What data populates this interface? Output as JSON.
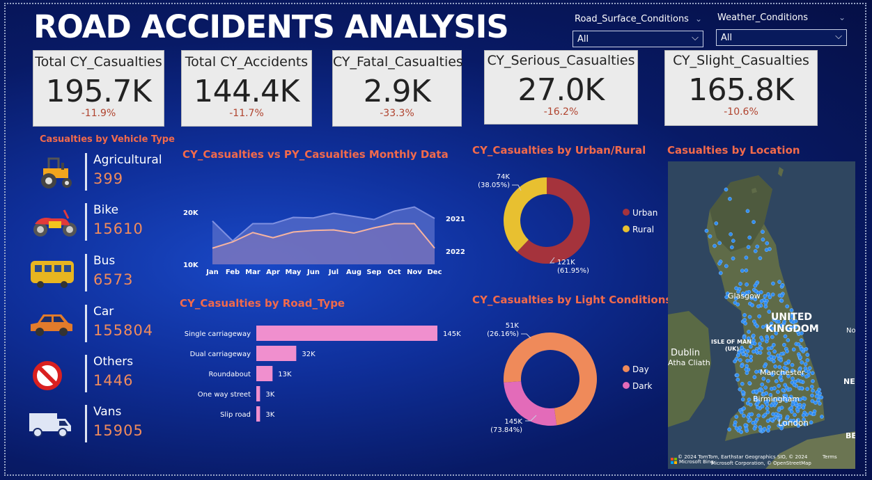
{
  "title": "ROAD ACCIDENTS ANALYSIS",
  "slicers": [
    {
      "label": "Road_Surface_Conditions",
      "value": "All"
    },
    {
      "label": "Weather_Conditions",
      "value": "All"
    }
  ],
  "cards": [
    {
      "label": "Total CY_Casualties",
      "value": "195.7K",
      "delta": "-11.9%"
    },
    {
      "label": "Total CY_Accidents",
      "value": "144.4K",
      "delta": "-11.7%"
    },
    {
      "label": "CY_Fatal_Casualties",
      "value": "2.9K",
      "delta": "-33.3%"
    },
    {
      "label": "CY_Serious_Casualties",
      "value": "27.0K",
      "delta": "-16.2%"
    },
    {
      "label": "CY_Slight_Casualties",
      "value": "165.8K",
      "delta": "-10.6%"
    }
  ],
  "vehicle": {
    "title": "Casualties by Vehicle Type",
    "items": [
      {
        "name": "Agricultural",
        "value": "399",
        "icon": "tractor-icon"
      },
      {
        "name": "Bike",
        "value": "15610",
        "icon": "motorbike-icon"
      },
      {
        "name": "Bus",
        "value": "6573",
        "icon": "bus-icon"
      },
      {
        "name": "Car",
        "value": "155804",
        "icon": "car-icon"
      },
      {
        "name": "Others",
        "value": "1446",
        "icon": "prohibited-icon"
      },
      {
        "name": "Vans",
        "value": "15905",
        "icon": "van-icon"
      }
    ]
  },
  "colors": {
    "accent_title": "#f26a4b",
    "urban": "#a5333c",
    "rural": "#e8c030",
    "day": "#ef8a5a",
    "dark": "#e36bb9",
    "bar": "#f08fce",
    "area_2021": "#5a6fc9",
    "line_2022": "#f7b4a0"
  },
  "charts": {
    "monthly": {
      "title": "CY_Casualties vs PY_Casualties Monthly Data",
      "y_ticks": [
        "20K",
        "10K"
      ]
    },
    "road_type": {
      "title": "CY_Casualties by Road_Type"
    },
    "urban_rural": {
      "title": "CY_Casualties by Urban/Rural"
    },
    "light": {
      "title": "CY_Casualties by Light Conditions"
    }
  },
  "chart_data": [
    {
      "type": "area",
      "categories": [
        "Jan",
        "Feb",
        "Mar",
        "Apr",
        "May",
        "Jun",
        "Jul",
        "Aug",
        "Sep",
        "Oct",
        "Nov",
        "Dec"
      ],
      "series": [
        {
          "name": "2021",
          "values": [
            18.3,
            14.5,
            17.8,
            17.8,
            19.0,
            18.9,
            19.8,
            19.2,
            18.6,
            20.2,
            21.0,
            18.8
          ]
        },
        {
          "name": "2022",
          "values": [
            13.1,
            14.3,
            16.1,
            15.1,
            16.2,
            16.5,
            16.6,
            16.0,
            17.0,
            17.8,
            17.8,
            13.1
          ]
        }
      ],
      "ylim": [
        10,
        22
      ]
    },
    {
      "type": "bar",
      "categories": [
        "Single carriageway",
        "Dual carriageway",
        "Roundabout",
        "One way street",
        "Slip road"
      ],
      "values": [
        145,
        32,
        13,
        3,
        3
      ],
      "labels": [
        "145K",
        "32K",
        "13K",
        "3K",
        "3K"
      ]
    },
    {
      "type": "pie",
      "categories": [
        "Urban",
        "Rural"
      ],
      "values": [
        121,
        74
      ],
      "percent": [
        61.95,
        38.05
      ],
      "labels": [
        "121K",
        "74K"
      ],
      "pct_labels": [
        "(61.95%)",
        "(38.05%)"
      ]
    },
    {
      "type": "pie",
      "categories": [
        "Day",
        "Dark"
      ],
      "values": [
        145,
        51
      ],
      "percent": [
        73.84,
        26.16
      ],
      "labels": [
        "145K",
        "51K"
      ],
      "pct_labels": [
        "(73.84%)",
        "(26.16%)"
      ]
    }
  ],
  "map": {
    "title": "Casualties by Location",
    "labels": [
      "UNITED",
      "KINGDOM",
      "Glasgow",
      "Dublin",
      "Atha Cliath",
      "ISLE OF MAN",
      "(UK)",
      "Manchester",
      "Birmingham",
      "London",
      "NE",
      "No",
      "BE"
    ],
    "copyright1": "© 2024 TomTom, Earthstar Geographics SIO, © 2024",
    "copyright2": "Microsoft Corporation, © OpenStreetMap",
    "terms": "Terms",
    "bing": "Microsoft Bing"
  }
}
